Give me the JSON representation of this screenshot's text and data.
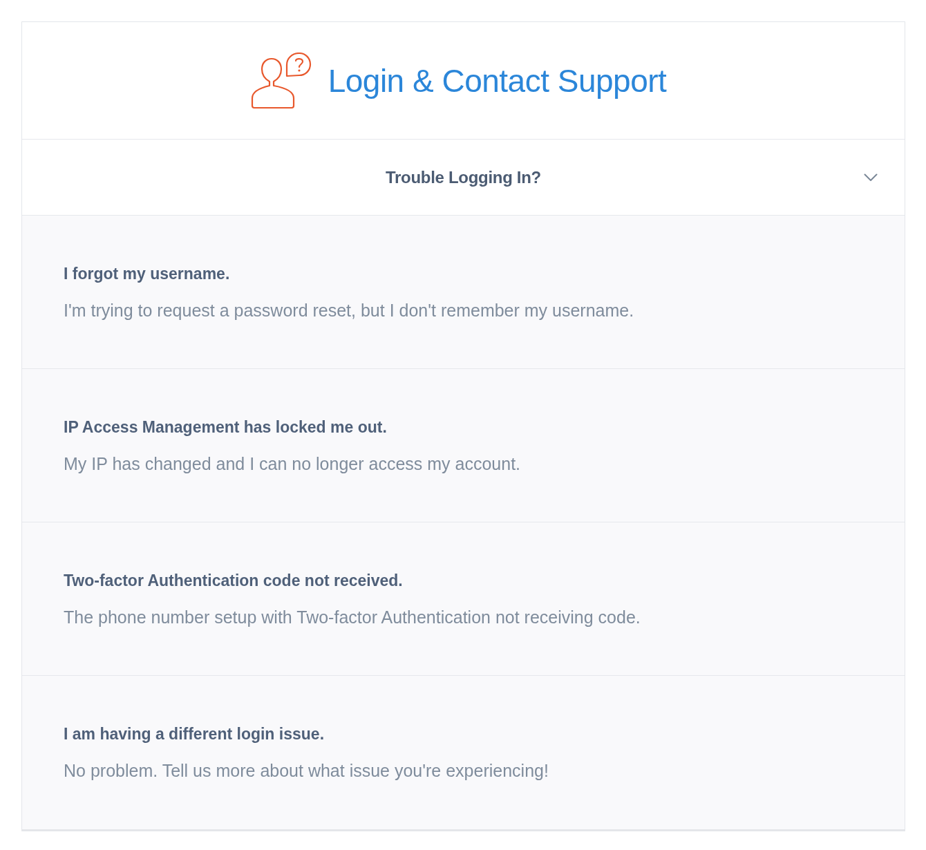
{
  "header": {
    "title": "Login & Contact Support"
  },
  "section": {
    "heading": "Trouble Logging In?"
  },
  "options": [
    {
      "title": "I forgot my username.",
      "description": "I'm trying to request a password reset, but I don't remember my username."
    },
    {
      "title": "IP Access Management has locked me out.",
      "description": "My IP has changed and I can no longer access my account."
    },
    {
      "title": "Two-factor Authentication code not received.",
      "description": "The phone number setup with Two-factor Authentication not receiving code."
    },
    {
      "title": "I am having a different login issue.",
      "description": "No problem. Tell us more about what issue you're experiencing!"
    }
  ]
}
